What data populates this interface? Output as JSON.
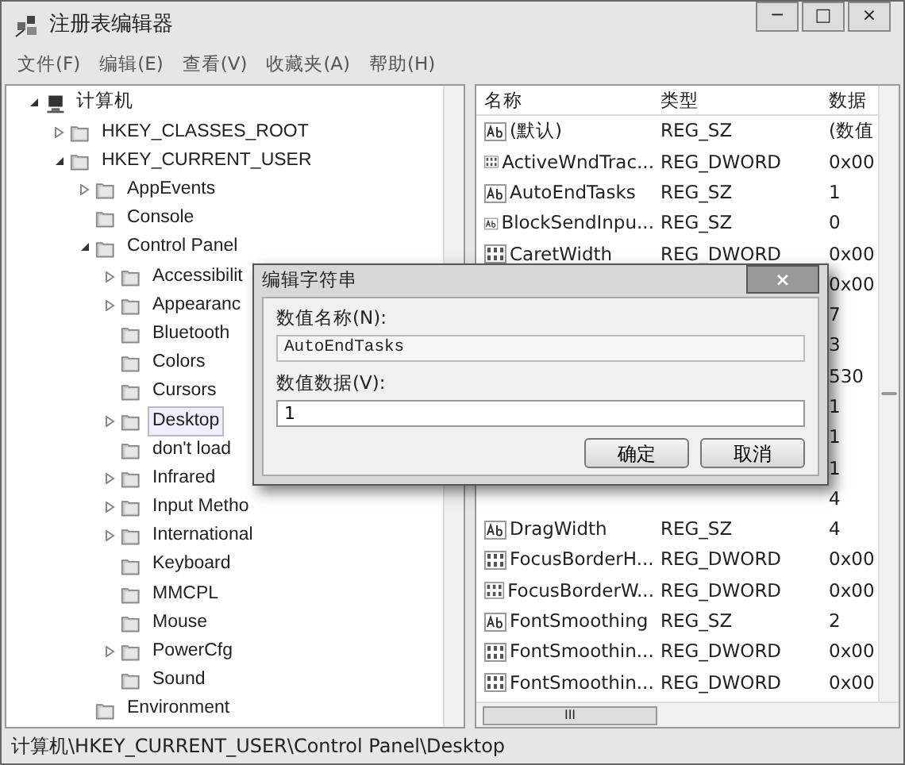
{
  "window": {
    "title": "注册表编辑器",
    "controls": [
      "─",
      "□",
      "×"
    ]
  },
  "menu": [
    "文件(F)",
    "编辑(E)",
    "查看(V)",
    "收藏夹(A)",
    "帮助(H)"
  ],
  "tree": [
    {
      "label": "计算机",
      "kind": "computer",
      "expanded": true,
      "selected": false,
      "children": [
        {
          "label": "HKEY_CLASSES_ROOT",
          "expanded": false,
          "selected": false
        },
        {
          "label": "HKEY_CURRENT_USER",
          "expanded": true,
          "selected": false,
          "children": [
            {
              "label": "AppEvents",
              "expanded": false,
              "selected": false
            },
            {
              "label": "Console",
              "selected": false
            },
            {
              "label": "Control Panel",
              "expanded": true,
              "selected": false,
              "children": [
                {
                  "label": "Accessibilit",
                  "expanded": false,
                  "selected": false
                },
                {
                  "label": "Appearanc",
                  "expanded": false,
                  "selected": false
                },
                {
                  "label": "Bluetooth",
                  "selected": false
                },
                {
                  "label": "Colors",
                  "selected": false
                },
                {
                  "label": "Cursors",
                  "selected": false
                },
                {
                  "label": "Desktop",
                  "expanded": false,
                  "selected": true
                },
                {
                  "label": "don't load",
                  "selected": false
                },
                {
                  "label": "Infrared",
                  "expanded": false,
                  "selected": false
                },
                {
                  "label": "Input Metho",
                  "expanded": false,
                  "selected": false
                },
                {
                  "label": "International",
                  "expanded": false,
                  "selected": false
                },
                {
                  "label": "Keyboard",
                  "selected": false
                },
                {
                  "label": "MMCPL",
                  "selected": false
                },
                {
                  "label": "Mouse",
                  "selected": false
                },
                {
                  "label": "PowerCfg",
                  "expanded": false,
                  "selected": false
                },
                {
                  "label": "Sound",
                  "selected": false
                }
              ]
            },
            {
              "label": "Environment",
              "selected": false
            }
          ]
        }
      ]
    }
  ],
  "table": {
    "columns": [
      "名称",
      "类型",
      "数据"
    ],
    "rows": [
      {
        "kind": "string",
        "name": "(默认)",
        "type": "REG_SZ",
        "data": "(数值"
      },
      {
        "kind": "number",
        "name": "ActiveWndTrac...",
        "type": "REG_DWORD",
        "data": "0x00"
      },
      {
        "kind": "string",
        "name": "AutoEndTasks",
        "type": "REG_SZ",
        "data": "1"
      },
      {
        "kind": "string",
        "name": "BlockSendInpu...",
        "type": "REG_SZ",
        "data": "0"
      },
      {
        "kind": "number",
        "name": "CaretWidth",
        "type": "REG_DWORD",
        "data": "0x00"
      },
      {
        "kind": "hidden",
        "data": "0x00"
      },
      {
        "kind": "hidden",
        "data": "7"
      },
      {
        "kind": "hidden",
        "data": "3"
      },
      {
        "kind": "hidden",
        "data": "530"
      },
      {
        "kind": "hidden",
        "data": "1"
      },
      {
        "kind": "hidden",
        "data": "1"
      },
      {
        "kind": "hidden",
        "data": "1"
      },
      {
        "kind": "hidden",
        "data": "4"
      },
      {
        "kind": "string",
        "name": "DragWidth",
        "type": "REG_SZ",
        "data": "4"
      },
      {
        "kind": "number",
        "name": "FocusBorderH...",
        "type": "REG_DWORD",
        "data": "0x00"
      },
      {
        "kind": "number",
        "name": "FocusBorderW...",
        "type": "REG_DWORD",
        "data": "0x00"
      },
      {
        "kind": "string",
        "name": "FontSmoothing",
        "type": "REG_SZ",
        "data": "2"
      },
      {
        "kind": "number",
        "name": "FontSmoothin...",
        "type": "REG_DWORD",
        "data": "0x00"
      },
      {
        "kind": "number",
        "name": "FontSmoothin...",
        "type": "REG_DWORD",
        "data": "0x00"
      }
    ],
    "hscroll_grip": "III"
  },
  "status_bar": "计算机\\HKEY_CURRENT_USER\\Control Panel\\Desktop",
  "dialog": {
    "title": "编辑字符串",
    "close": "×",
    "name_label": "数值名称(N):",
    "name_value": "AutoEndTasks",
    "data_label": "数值数据(V):",
    "data_value": "1",
    "buttons": [
      "确定",
      "取消"
    ]
  }
}
